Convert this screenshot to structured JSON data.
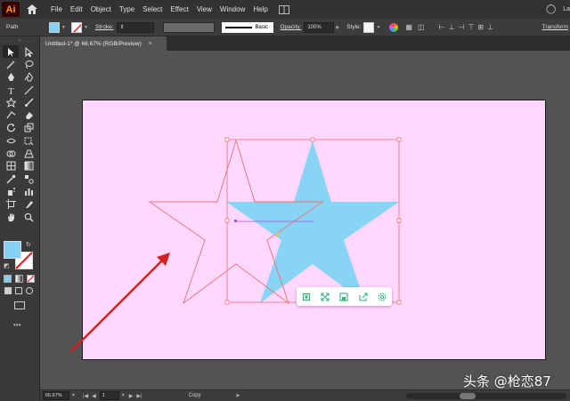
{
  "app": {
    "logo": "Ai"
  },
  "menu": {
    "items": [
      "File",
      "Edit",
      "Object",
      "Type",
      "Select",
      "Effect",
      "View",
      "Window",
      "Help"
    ],
    "right_label": "La"
  },
  "controlbar": {
    "selection_type": "Path",
    "stroke_label": "Stroke:",
    "stroke_weight": "",
    "brush_label": "Basic",
    "opacity_label": "Opacity:",
    "opacity_value": "100%",
    "style_label": "Style:",
    "transform_label": "Transform",
    "fill_color": "#87cff5"
  },
  "document": {
    "tab_title": "Untitled-1* @ 66.67% (RGB/Preview)",
    "close_glyph": "×",
    "artboard_color": "#ffd7ff"
  },
  "toolbox": {
    "grip": "»",
    "tools": [
      "selection-tool",
      "direct-selection-tool",
      "magic-wand-tool",
      "lasso-tool",
      "pen-tool",
      "curvature-tool",
      "type-tool",
      "line-segment-tool",
      "star-tool",
      "paintbrush-tool",
      "shaper-tool",
      "eraser-tool",
      "rotate-tool",
      "scale-tool",
      "width-tool",
      "free-transform-tool",
      "shape-builder-tool",
      "perspective-grid-tool",
      "mesh-tool",
      "gradient-tool",
      "eyedropper-tool",
      "blend-tool",
      "symbol-sprayer-tool",
      "column-graph-tool",
      "artboard-tool",
      "slice-tool",
      "hand-tool",
      "zoom-tool"
    ],
    "more": "•••"
  },
  "floating_toolbar": {
    "buttons": [
      "copy-icon",
      "fullscreen-icon",
      "save-icon",
      "share-icon",
      "settings-icon"
    ],
    "accent": "#2fb67a"
  },
  "statusbar": {
    "zoom": "66.67%",
    "artboard_number": "1",
    "status_text": "Copy"
  },
  "watermark": "头条 @枪恋87",
  "colors": {
    "selection": "#f26d6d",
    "star_fill": "#87d4f5",
    "arrow": "#d32020"
  }
}
